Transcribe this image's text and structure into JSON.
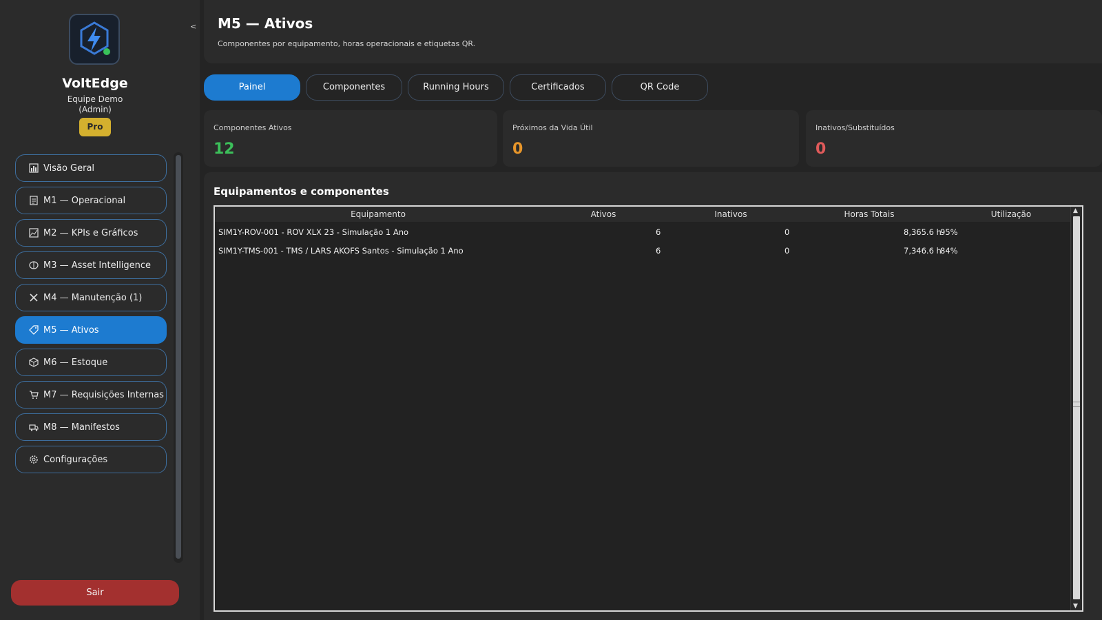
{
  "sidebar": {
    "collapse_label": "<",
    "brand_name": "VoltEdge",
    "team_line1": "Equipe Demo",
    "team_line2": "(Admin)",
    "plan_badge": "Pro",
    "items": [
      {
        "label": "Visão Geral",
        "icon": "bar-chart-icon"
      },
      {
        "label": "M1 — Operacional",
        "icon": "clipboard-icon"
      },
      {
        "label": "M2 — KPIs e Gráficos",
        "icon": "chart-grid-icon"
      },
      {
        "label": "M3 — Asset Intelligence",
        "icon": "brain-icon"
      },
      {
        "label": "M4 — Manutenção (1)",
        "icon": "tools-icon"
      },
      {
        "label": "M5 — Ativos",
        "icon": "tag-icon"
      },
      {
        "label": "M6 — Estoque",
        "icon": "box-icon"
      },
      {
        "label": "M7 — Requisições Internas",
        "icon": "cart-icon"
      },
      {
        "label": "M8 — Manifestos",
        "icon": "truck-icon"
      },
      {
        "label": "Configurações",
        "icon": "gear-icon"
      }
    ],
    "active_index": 5,
    "logout_label": "Sair"
  },
  "header": {
    "title": "M5 — Ativos",
    "subtitle": "Componentes por equipamento, horas operacionais e etiquetas QR."
  },
  "tabs": [
    "Painel",
    "Componentes",
    "Running Hours",
    "Certificados",
    "QR Code"
  ],
  "active_tab": 0,
  "cards": [
    {
      "label": "Componentes Ativos",
      "value": "12",
      "color": "#3cbf5a"
    },
    {
      "label": "Próximos da Vida Útil",
      "value": "0",
      "color": "#e8962a"
    },
    {
      "label": "Inativos/Substituídos",
      "value": "0",
      "color": "#e05a5a"
    }
  ],
  "panel": {
    "title": "Equipamentos e componentes",
    "columns": [
      "Equipamento",
      "Ativos",
      "Inativos",
      "Horas Totais",
      "Utilização"
    ],
    "rows": [
      {
        "equipamento": "SIM1Y-ROV-001 - ROV XLX 23 - Simulação 1 Ano",
        "ativos": "6",
        "inativos": "0",
        "horas": "8,365.6 h",
        "utilizacao": "95%"
      },
      {
        "equipamento": "SIM1Y-TMS-001 - TMS / LARS AKOFS Santos - Simulação 1 Ano",
        "ativos": "6",
        "inativos": "0",
        "horas": "7,346.6 h",
        "utilizacao": "84%"
      }
    ]
  },
  "colors": {
    "accent": "#1d7bd0",
    "logout": "#a3302f",
    "badge": "#d4b02e"
  }
}
